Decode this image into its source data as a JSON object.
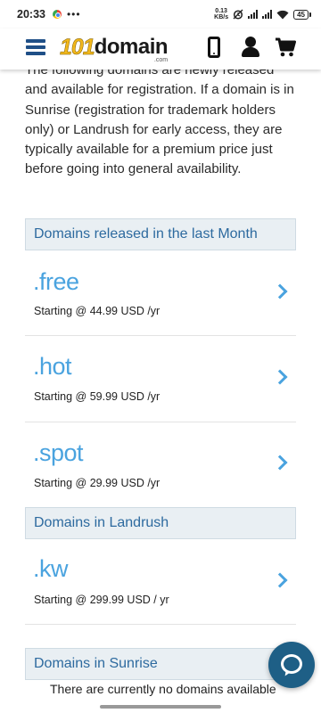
{
  "status_bar": {
    "time": "20:33",
    "more": "•••",
    "speed_value": "0.13",
    "speed_unit": "KB/s",
    "battery": "45",
    "icons": [
      "chrome-icon",
      "alarm-icon",
      "signal-icon",
      "signal-icon",
      "wifi-icon",
      "battery-icon"
    ]
  },
  "header": {
    "logo_number": "101",
    "logo_word": "domain",
    "logo_tld": ".com",
    "icons": [
      "menu-icon",
      "phone-icon",
      "user-icon",
      "cart-icon"
    ],
    "brand_color": "#1f4f87",
    "logo_color": "#f2b81c"
  },
  "intro_text": "The following domains are newly released and available for registration. If a domain is in Sunrise (registration for trademark holders only) or Landrush for early access, they are typically available for a premium price just before going into general availability.",
  "sections": [
    {
      "title": "Domains released in the last Month",
      "domains": [
        {
          "name": ".free",
          "price": "Starting @ 44.99 USD /yr"
        },
        {
          "name": ".hot",
          "price": "Starting @ 59.99 USD /yr"
        },
        {
          "name": ".spot",
          "price": "Starting @ 29.99 USD /yr"
        }
      ]
    },
    {
      "title": "Domains in Landrush",
      "domains": [
        {
          "name": ".kw",
          "price": "Starting @ 299.99 USD / yr"
        }
      ]
    },
    {
      "title": "Domains in Sunrise",
      "empty_text": "There are currently no domains available"
    }
  ],
  "colors": {
    "accent": "#4aa3df",
    "section_text": "#2d6a9f",
    "section_bg": "#e9eff3",
    "chat_button": "#1e5f86"
  }
}
